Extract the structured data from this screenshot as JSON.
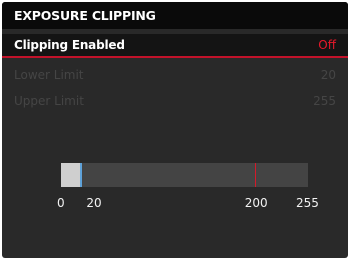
{
  "header": {
    "title": "EXPOSURE CLIPPING"
  },
  "menu": {
    "items": [
      {
        "label": "Clipping Enabled",
        "value": "Off",
        "selected": true,
        "enabled": true
      },
      {
        "label": "Lower Limit",
        "value": "20",
        "selected": false,
        "enabled": false
      },
      {
        "label": "Upper Limit",
        "value": "255",
        "selected": false,
        "enabled": false
      }
    ]
  },
  "scale": {
    "min": 0,
    "max": 255,
    "lower": 20,
    "upper": 200,
    "ticks": [
      "0",
      "20",
      "200",
      "255"
    ]
  },
  "colors": {
    "accent_red": "#c2122a",
    "marker_blue": "#5fa2d9",
    "background": "#292929"
  }
}
